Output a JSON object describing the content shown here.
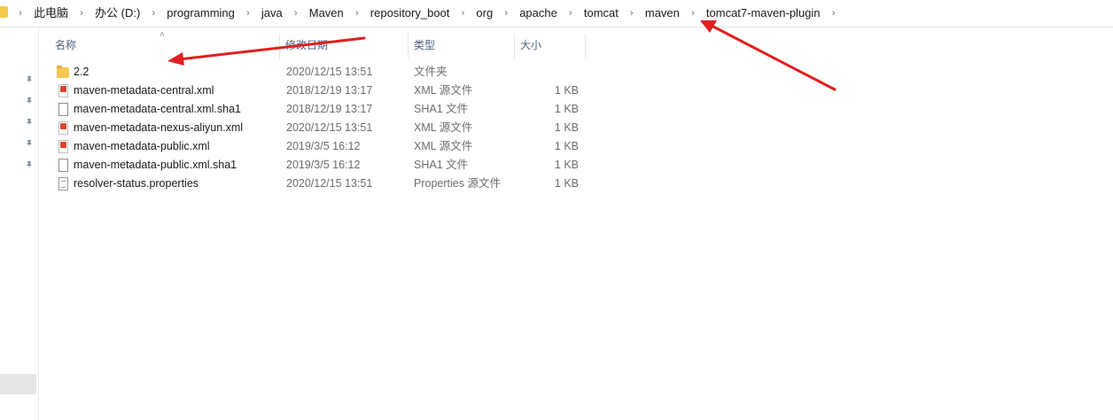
{
  "breadcrumb": {
    "items": [
      "此电脑",
      "办公 (D:)",
      "programming",
      "java",
      "Maven",
      "repository_boot",
      "org",
      "apache",
      "tomcat",
      "maven",
      "tomcat7-maven-plugin"
    ]
  },
  "columns": {
    "name": "名称",
    "modified": "修改日期",
    "type": "类型",
    "size": "大小"
  },
  "files": [
    {
      "icon": "folder-icon",
      "name": "2.2",
      "modified": "2020/12/15 13:51",
      "type": "文件夹",
      "size": ""
    },
    {
      "icon": "xml-file-icon",
      "name": "maven-metadata-central.xml",
      "modified": "2018/12/19 13:17",
      "type": "XML 源文件",
      "size": "1 KB"
    },
    {
      "icon": "file-icon",
      "name": "maven-metadata-central.xml.sha1",
      "modified": "2018/12/19 13:17",
      "type": "SHA1 文件",
      "size": "1 KB"
    },
    {
      "icon": "xml-file-icon",
      "name": "maven-metadata-nexus-aliyun.xml",
      "modified": "2020/12/15 13:51",
      "type": "XML 源文件",
      "size": "1 KB"
    },
    {
      "icon": "xml-file-icon",
      "name": "maven-metadata-public.xml",
      "modified": "2019/3/5 16:12",
      "type": "XML 源文件",
      "size": "1 KB"
    },
    {
      "icon": "file-icon",
      "name": "maven-metadata-public.xml.sha1",
      "modified": "2019/3/5 16:12",
      "type": "SHA1 文件",
      "size": "1 KB"
    },
    {
      "icon": "properties-file-icon",
      "name": "resolver-status.properties",
      "modified": "2020/12/15 13:51",
      "type": "Properties 源文件",
      "size": "1 KB"
    }
  ],
  "colors": {
    "annotation_arrow": "#e0201f",
    "header_text": "#4d6082",
    "folder": "#f6c954"
  }
}
